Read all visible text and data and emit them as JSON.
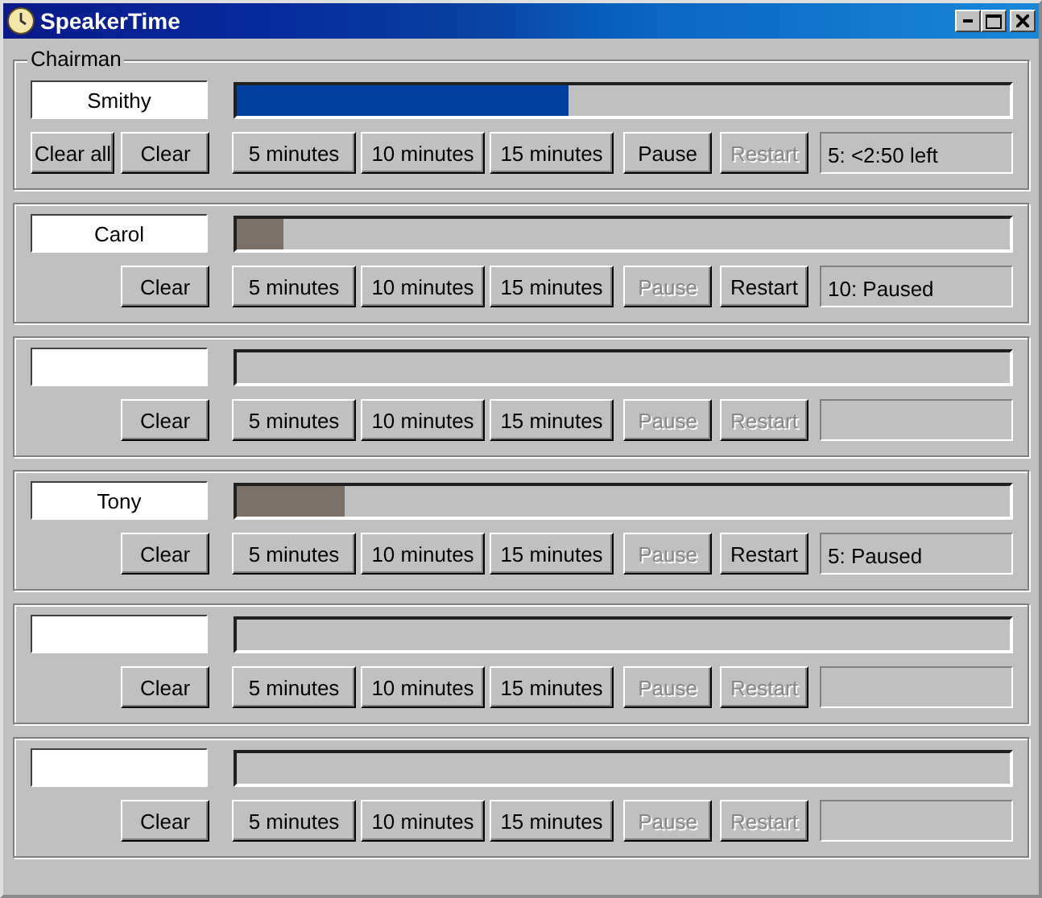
{
  "window": {
    "title": "SpeakerTime"
  },
  "speakers": [
    {
      "label": "Chairman",
      "name": "Smithy",
      "level": 0.43,
      "color": "#0041a0",
      "clear_all": "Clear all",
      "clear": "Clear",
      "durations": [
        "5 minutes",
        "10 minutes",
        "15 minutes"
      ],
      "pause": {
        "label": "Pause",
        "disabled": false
      },
      "restart": {
        "label": "Restart",
        "disabled": true
      },
      "status": "5: <2:50 left"
    },
    {
      "name": "Carol",
      "level": 0.06,
      "color": "#7a7068",
      "clear": "Clear",
      "durations": [
        "5 minutes",
        "10 minutes",
        "15 minutes"
      ],
      "pause": {
        "label": "Pause",
        "disabled": true
      },
      "restart": {
        "label": "Restart",
        "disabled": false
      },
      "status": "10: Paused"
    },
    {
      "clear": "Clear",
      "durations": [
        "5 minutes",
        "10 minutes",
        "15 minutes"
      ],
      "pause": {
        "label": "Pause",
        "disabled": true
      },
      "restart": {
        "label": "Restart",
        "disabled": true
      }
    },
    {
      "name": "Tony",
      "level": 0.14,
      "color": "#7a7068",
      "clear": "Clear",
      "durations": [
        "5 minutes",
        "10 minutes",
        "15 minutes"
      ],
      "pause": {
        "label": "Pause",
        "disabled": true
      },
      "restart": {
        "label": "Restart",
        "disabled": false
      },
      "status": "5: Paused"
    },
    {
      "clear": "Clear",
      "durations": [
        "5 minutes",
        "10 minutes",
        "15 minutes"
      ],
      "pause": {
        "label": "Pause",
        "disabled": true
      },
      "restart": {
        "label": "Restart",
        "disabled": true
      }
    },
    {
      "clear": "Clear",
      "durations": [
        "5 minutes",
        "10 minutes",
        "15 minutes"
      ],
      "pause": {
        "label": "Pause",
        "disabled": true
      },
      "restart": {
        "label": "Restart",
        "disabled": true
      }
    }
  ]
}
